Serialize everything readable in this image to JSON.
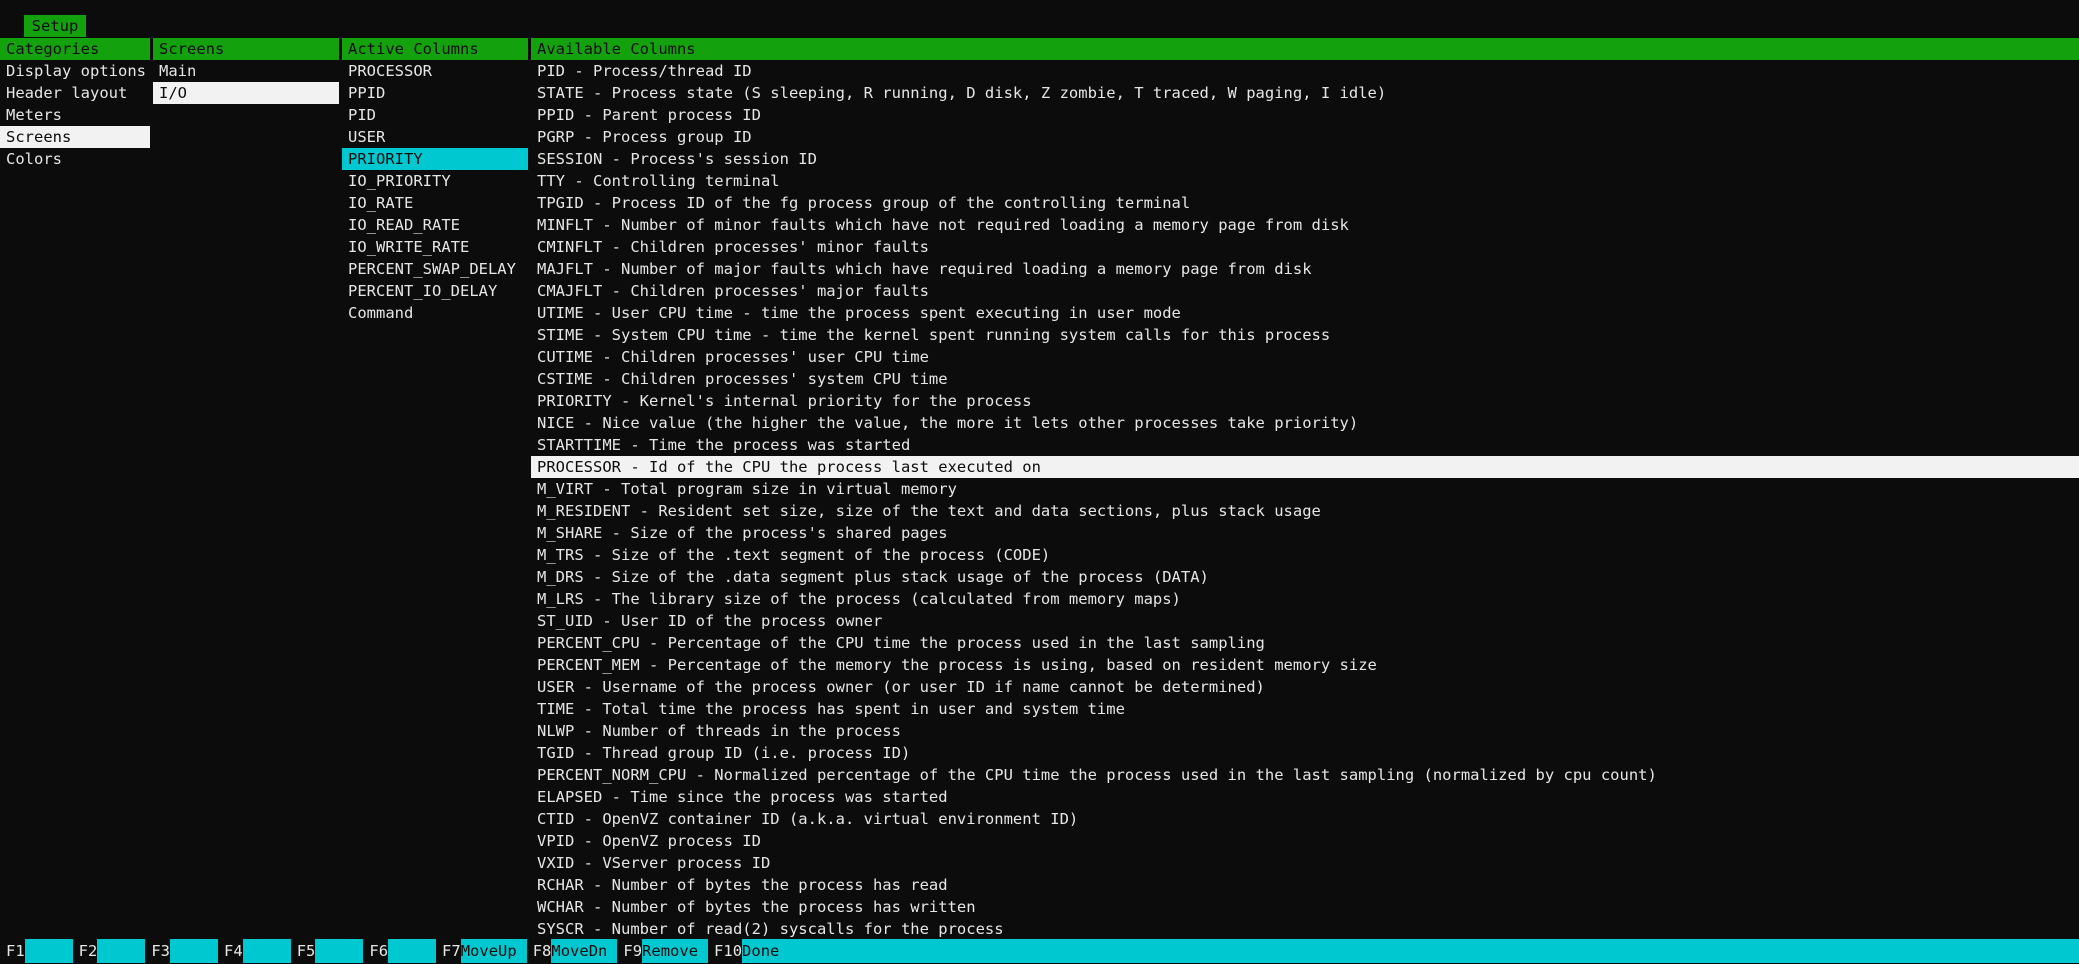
{
  "tabs": {
    "setup": "Setup"
  },
  "headers": {
    "categories": "Categories",
    "screens": "Screens",
    "active_columns": "Active Columns",
    "available_columns": "Available Columns"
  },
  "categories": [
    "Display options",
    "Header layout",
    "Meters",
    "Screens",
    "Colors"
  ],
  "screens": [
    "Main",
    "I/O"
  ],
  "active_columns": [
    "PROCESSOR",
    "PPID",
    "PID",
    "USER",
    "PRIORITY",
    "IO_PRIORITY",
    "IO_RATE",
    "IO_READ_RATE",
    "IO_WRITE_RATE",
    "PERCENT_SWAP_DELAY",
    "PERCENT_IO_DELAY",
    "Command"
  ],
  "available_columns": [
    "PID - Process/thread ID",
    "STATE - Process state (S sleeping, R running, D disk, Z zombie, T traced, W paging, I idle)",
    "PPID - Parent process ID",
    "PGRP - Process group ID",
    "SESSION - Process's session ID",
    "TTY - Controlling terminal",
    "TPGID - Process ID of the fg process group of the controlling terminal",
    "MINFLT - Number of minor faults which have not required loading a memory page from disk",
    "CMINFLT - Children processes' minor faults",
    "MAJFLT - Number of major faults which have required loading a memory page from disk",
    "CMAJFLT - Children processes' major faults",
    "UTIME - User CPU time - time the process spent executing in user mode",
    "STIME - System CPU time - time the kernel spent running system calls for this process",
    "CUTIME - Children processes' user CPU time",
    "CSTIME - Children processes' system CPU time",
    "PRIORITY - Kernel's internal priority for the process",
    "NICE - Nice value (the higher the value, the more it lets other processes take priority)",
    "STARTTIME - Time the process was started",
    "PROCESSOR - Id of the CPU the process last executed on",
    "M_VIRT - Total program size in virtual memory",
    "M_RESIDENT - Resident set size, size of the text and data sections, plus stack usage",
    "M_SHARE - Size of the process's shared pages",
    "M_TRS - Size of the .text segment of the process (CODE)",
    "M_DRS - Size of the .data segment plus stack usage of the process (DATA)",
    "M_LRS - The library size of the process (calculated from memory maps)",
    "ST_UID - User ID of the process owner",
    "PERCENT_CPU - Percentage of the CPU time the process used in the last sampling",
    "PERCENT_MEM - Percentage of the memory the process is using, based on resident memory size",
    "USER - Username of the process owner (or user ID if name cannot be determined)",
    "TIME - Total time the process has spent in user and system time",
    "NLWP - Number of threads in the process",
    "TGID - Thread group ID (i.e. process ID)",
    "PERCENT_NORM_CPU - Normalized percentage of the CPU time the process used in the last sampling (normalized by cpu count)",
    "ELAPSED - Time since the process was started",
    "CTID - OpenVZ container ID (a.k.a. virtual environment ID)",
    "VPID - OpenVZ process ID",
    "VXID - VServer process ID",
    "RCHAR - Number of bytes the process has read",
    "WCHAR - Number of bytes the process has written",
    "SYSCR - Number of read(2) syscalls for the process"
  ],
  "selected": {
    "category": 3,
    "screen": 1,
    "active_column": 4,
    "available_column": 18
  },
  "fkeys": [
    {
      "key": "F1",
      "label": ""
    },
    {
      "key": "F2",
      "label": ""
    },
    {
      "key": "F3",
      "label": ""
    },
    {
      "key": "F4",
      "label": ""
    },
    {
      "key": "F5",
      "label": ""
    },
    {
      "key": "F6",
      "label": ""
    },
    {
      "key": "F7",
      "label": "MoveUp"
    },
    {
      "key": "F8",
      "label": "MoveDn"
    },
    {
      "key": "F9",
      "label": "Remove"
    },
    {
      "key": "F10",
      "label": "Done"
    }
  ],
  "colors": {
    "green": "#13a10e",
    "cyan": "#00c8d0",
    "white": "#f2f2f2",
    "background": "#0c0c0c"
  }
}
